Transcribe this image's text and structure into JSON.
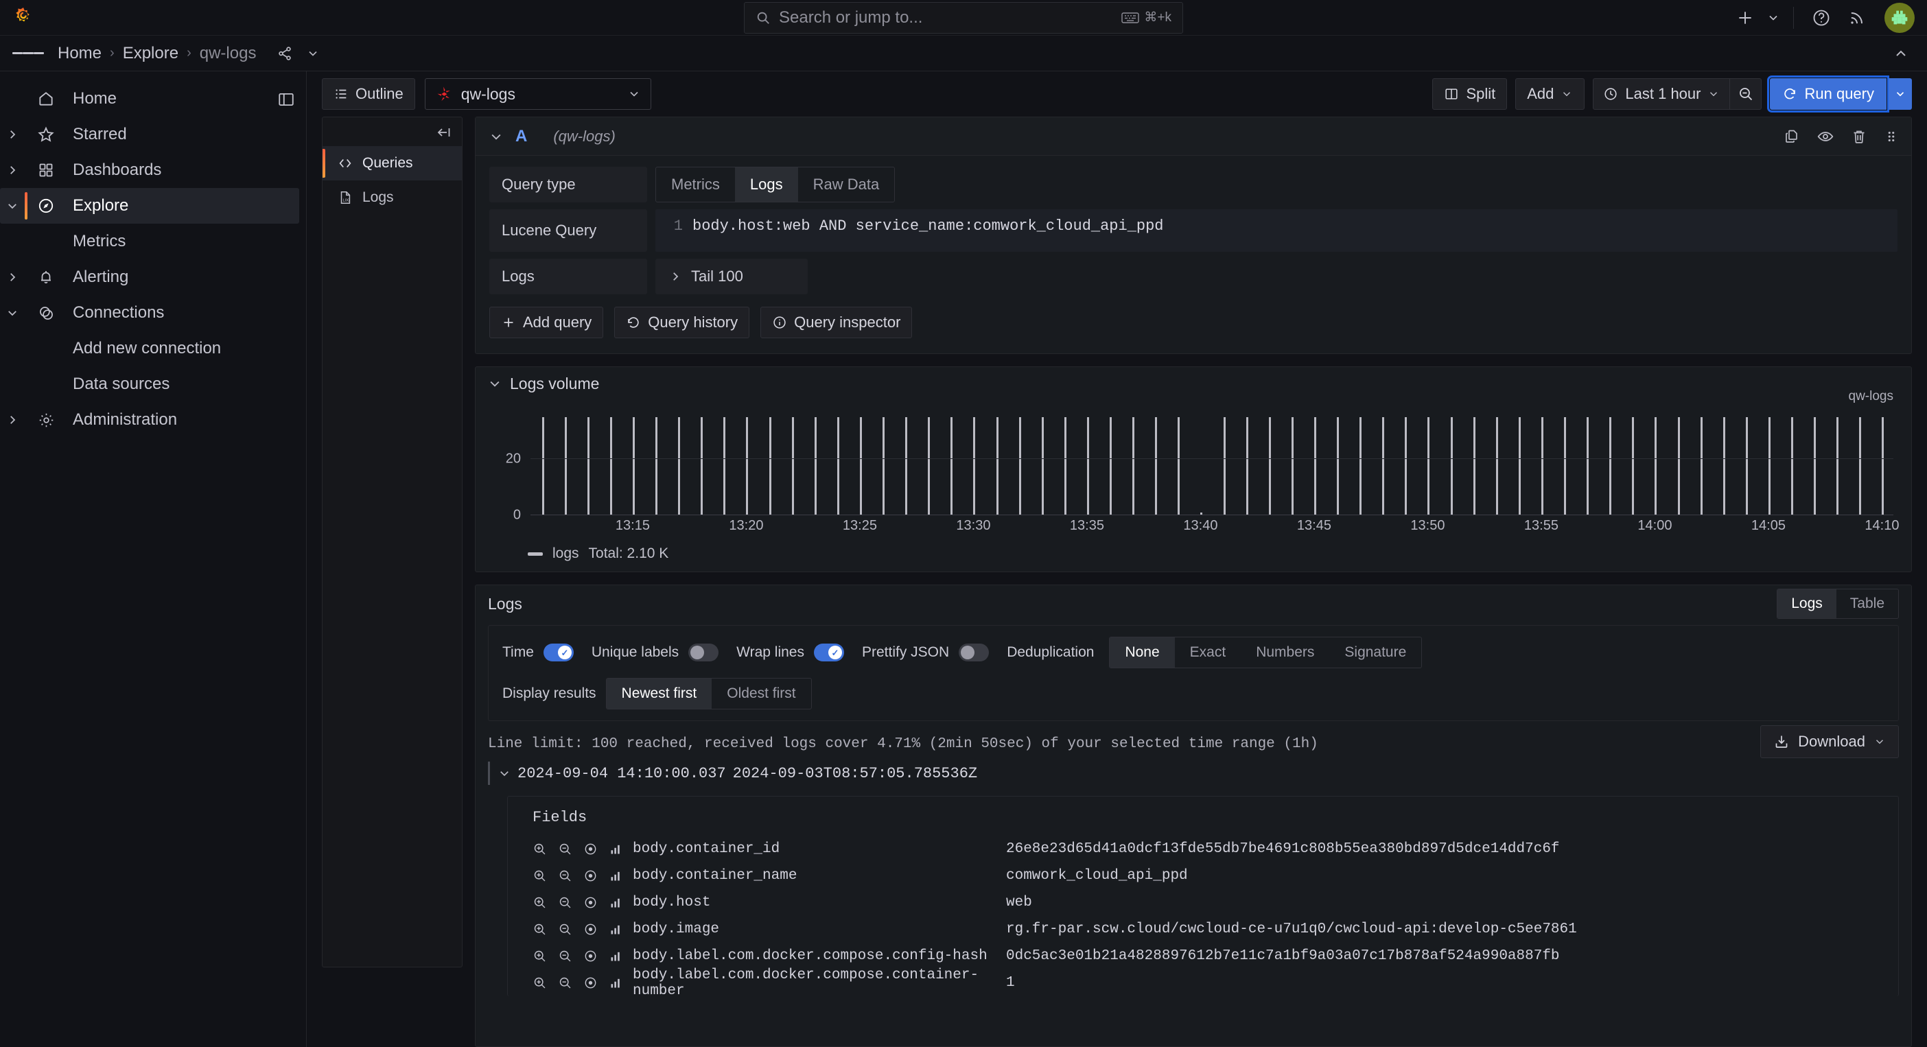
{
  "topbar": {
    "logo_name": "grafana-logo",
    "search": {
      "placeholder": "Search or jump to...",
      "shortcut": "⌘+k"
    },
    "actions": [
      {
        "name": "add-new-button",
        "label": "+"
      },
      {
        "name": "help-button",
        "label": "?"
      },
      {
        "name": "news-button",
        "label": "rss"
      }
    ],
    "avatar_label": "profile-avatar"
  },
  "breadcrumb": {
    "items": [
      {
        "label": "Home",
        "current": false
      },
      {
        "label": "Explore",
        "current": false
      },
      {
        "label": "qw-logs",
        "current": true
      }
    ],
    "share_label": "share",
    "more_label": "more"
  },
  "sidebar": {
    "items": [
      {
        "label": "Home",
        "icon": "home-icon",
        "expandable": false,
        "active": false,
        "child": false
      },
      {
        "label": "Starred",
        "icon": "star-icon",
        "expandable": true,
        "expanded": false,
        "active": false,
        "child": false
      },
      {
        "label": "Dashboards",
        "icon": "dashboards-icon",
        "expandable": true,
        "expanded": false,
        "active": false,
        "child": false
      },
      {
        "label": "Explore",
        "icon": "compass-icon",
        "expandable": true,
        "expanded": true,
        "active": true,
        "child": false
      },
      {
        "label": "Metrics",
        "icon": "",
        "expandable": false,
        "active": false,
        "child": true
      },
      {
        "label": "Alerting",
        "icon": "bell-icon",
        "expandable": true,
        "expanded": false,
        "active": false,
        "child": false
      },
      {
        "label": "Connections",
        "icon": "connections-icon",
        "expandable": true,
        "expanded": true,
        "active": false,
        "child": false
      },
      {
        "label": "Add new connection",
        "icon": "",
        "expandable": false,
        "active": false,
        "child": true
      },
      {
        "label": "Data sources",
        "icon": "",
        "expandable": false,
        "active": false,
        "child": true
      },
      {
        "label": "Administration",
        "icon": "gear-icon",
        "expandable": true,
        "expanded": false,
        "active": false,
        "child": false
      }
    ],
    "dock_label": "dock-menu"
  },
  "toolbar": {
    "outline_label": "Outline",
    "datasource": "qw-logs",
    "split_label": "Split",
    "add_label": "Add",
    "time_range": "Last 1 hour",
    "zoom_out_label": "zoom-out",
    "run_query_label": "Run query"
  },
  "outline": {
    "items": [
      {
        "label": "Queries",
        "icon": "code-icon",
        "active": true
      },
      {
        "label": "Logs",
        "icon": "log-file-icon",
        "active": false
      }
    ]
  },
  "query": {
    "letter": "A",
    "datasource_label": "(qw-logs)",
    "query_type_label": "Query type",
    "query_types": [
      {
        "label": "Metrics",
        "active": false
      },
      {
        "label": "Logs",
        "active": true
      },
      {
        "label": "Raw Data",
        "active": false
      }
    ],
    "lucene_label": "Lucene Query",
    "lucene_line_no": "1",
    "lucene_value": "body.host:web AND service_name:comwork_cloud_api_ppd",
    "logs_label": "Logs",
    "tail_label": "Tail 100",
    "row_actions": [
      {
        "name": "duplicate-query-icon"
      },
      {
        "name": "toggle-query-visibility-icon"
      },
      {
        "name": "remove-query-icon"
      },
      {
        "name": "drag-query-icon"
      }
    ],
    "actions": [
      {
        "label": "Add query",
        "icon": "plus-icon",
        "name": "add-query-button"
      },
      {
        "label": "Query history",
        "icon": "history-icon",
        "name": "query-history-button"
      },
      {
        "label": "Query inspector",
        "icon": "info-icon",
        "name": "query-inspector-button"
      }
    ]
  },
  "logs_volume": {
    "title": "Logs volume",
    "legend_label": "logs",
    "legend_total": "Total: 2.10 K"
  },
  "chart_data": {
    "type": "bar",
    "title": "Logs volume",
    "series_label": "qw-logs",
    "xlabel": "",
    "ylabel": "",
    "ylim": [
      0,
      40
    ],
    "yticks": [
      0,
      20
    ],
    "ytick_labels": [
      "0",
      "20"
    ],
    "xtick_labels": [
      "13:15",
      "13:20",
      "13:25",
      "13:30",
      "13:35",
      "13:40",
      "13:45",
      "13:50",
      "13:55",
      "14:00",
      "14:05",
      "14:10"
    ],
    "x_start": "13:11",
    "x_end": "14:11",
    "bar_color": "#bcbcc4",
    "grid": true,
    "legend_position": "bottom-left",
    "total": "2.10 K",
    "x": [
      "13:11",
      "13:12",
      "13:13",
      "13:14",
      "13:15",
      "13:16",
      "13:17",
      "13:18",
      "13:19",
      "13:20",
      "13:21",
      "13:22",
      "13:23",
      "13:24",
      "13:25",
      "13:26",
      "13:27",
      "13:28",
      "13:29",
      "13:30",
      "13:31",
      "13:32",
      "13:33",
      "13:34",
      "13:35",
      "13:36",
      "13:37",
      "13:38",
      "13:39",
      "13:40",
      "13:41",
      "13:42",
      "13:43",
      "13:44",
      "13:45",
      "13:46",
      "13:47",
      "13:48",
      "13:49",
      "13:50",
      "13:51",
      "13:52",
      "13:53",
      "13:54",
      "13:55",
      "13:56",
      "13:57",
      "13:58",
      "13:59",
      "14:00",
      "14:01",
      "14:02",
      "14:03",
      "14:04",
      "14:05",
      "14:06",
      "14:07",
      "14:08",
      "14:09",
      "14:10"
    ],
    "values": [
      35,
      35,
      35,
      35,
      35,
      35,
      35,
      35,
      35,
      35,
      35,
      35,
      35,
      35,
      35,
      35,
      35,
      35,
      35,
      35,
      35,
      35,
      35,
      35,
      35,
      35,
      35,
      35,
      35,
      1,
      35,
      35,
      35,
      35,
      35,
      35,
      35,
      35,
      35,
      35,
      35,
      35,
      35,
      35,
      35,
      35,
      35,
      35,
      35,
      35,
      35,
      35,
      35,
      35,
      35,
      35,
      35,
      35,
      35,
      35
    ]
  },
  "logs_panel": {
    "title": "Logs",
    "view_tabs": [
      {
        "label": "Logs",
        "active": true
      },
      {
        "label": "Table",
        "active": false
      }
    ],
    "toggles": [
      {
        "label": "Time",
        "on": true,
        "name": "time-toggle"
      },
      {
        "label": "Unique labels",
        "on": false,
        "name": "unique-labels-toggle"
      },
      {
        "label": "Wrap lines",
        "on": true,
        "name": "wrap-lines-toggle"
      },
      {
        "label": "Prettify JSON",
        "on": false,
        "name": "prettify-json-toggle"
      }
    ],
    "dedup_label": "Deduplication",
    "dedup_options": [
      {
        "label": "None",
        "active": true
      },
      {
        "label": "Exact",
        "active": false
      },
      {
        "label": "Numbers",
        "active": false
      },
      {
        "label": "Signature",
        "active": false
      }
    ],
    "display_label": "Display results",
    "display_options": [
      {
        "label": "Newest first",
        "active": true
      },
      {
        "label": "Oldest first",
        "active": false
      }
    ],
    "limit_text": "Line limit: 100 reached, received logs cover 4.71% (2min 50sec) of your selected time range (1h)",
    "download_label": "Download"
  },
  "log_entry": {
    "timestamp": "2024-09-04 14:10:00.037",
    "body_timestamp": "2024-09-03T08:57:05.785536Z",
    "fields_title": "Fields",
    "fields": [
      {
        "key": "body.container_id",
        "value": "26e8e23d65d41a0dcf13fde55db7be4691c808b55ea380bd897d5dce14dd7c6f"
      },
      {
        "key": "body.container_name",
        "value": "comwork_cloud_api_ppd"
      },
      {
        "key": "body.host",
        "value": "web"
      },
      {
        "key": "body.image",
        "value": "rg.fr-par.scw.cloud/cwcloud-ce-u7u1q0/cwcloud-api:develop-c5ee7861"
      },
      {
        "key": "body.label.com.docker.compose.config-hash",
        "value": "0dc5ac3e01b21a4828897612b7e11c7a1bf9a03a07c17b878af524a990a887fb"
      },
      {
        "key": "body.label.com.docker.compose.container-number",
        "value": "1"
      }
    ],
    "field_row_icons": [
      {
        "name": "filter-for-value-icon"
      },
      {
        "name": "filter-out-value-icon"
      },
      {
        "name": "toggle-field-visibility-icon"
      },
      {
        "name": "field-stats-icon"
      }
    ]
  }
}
